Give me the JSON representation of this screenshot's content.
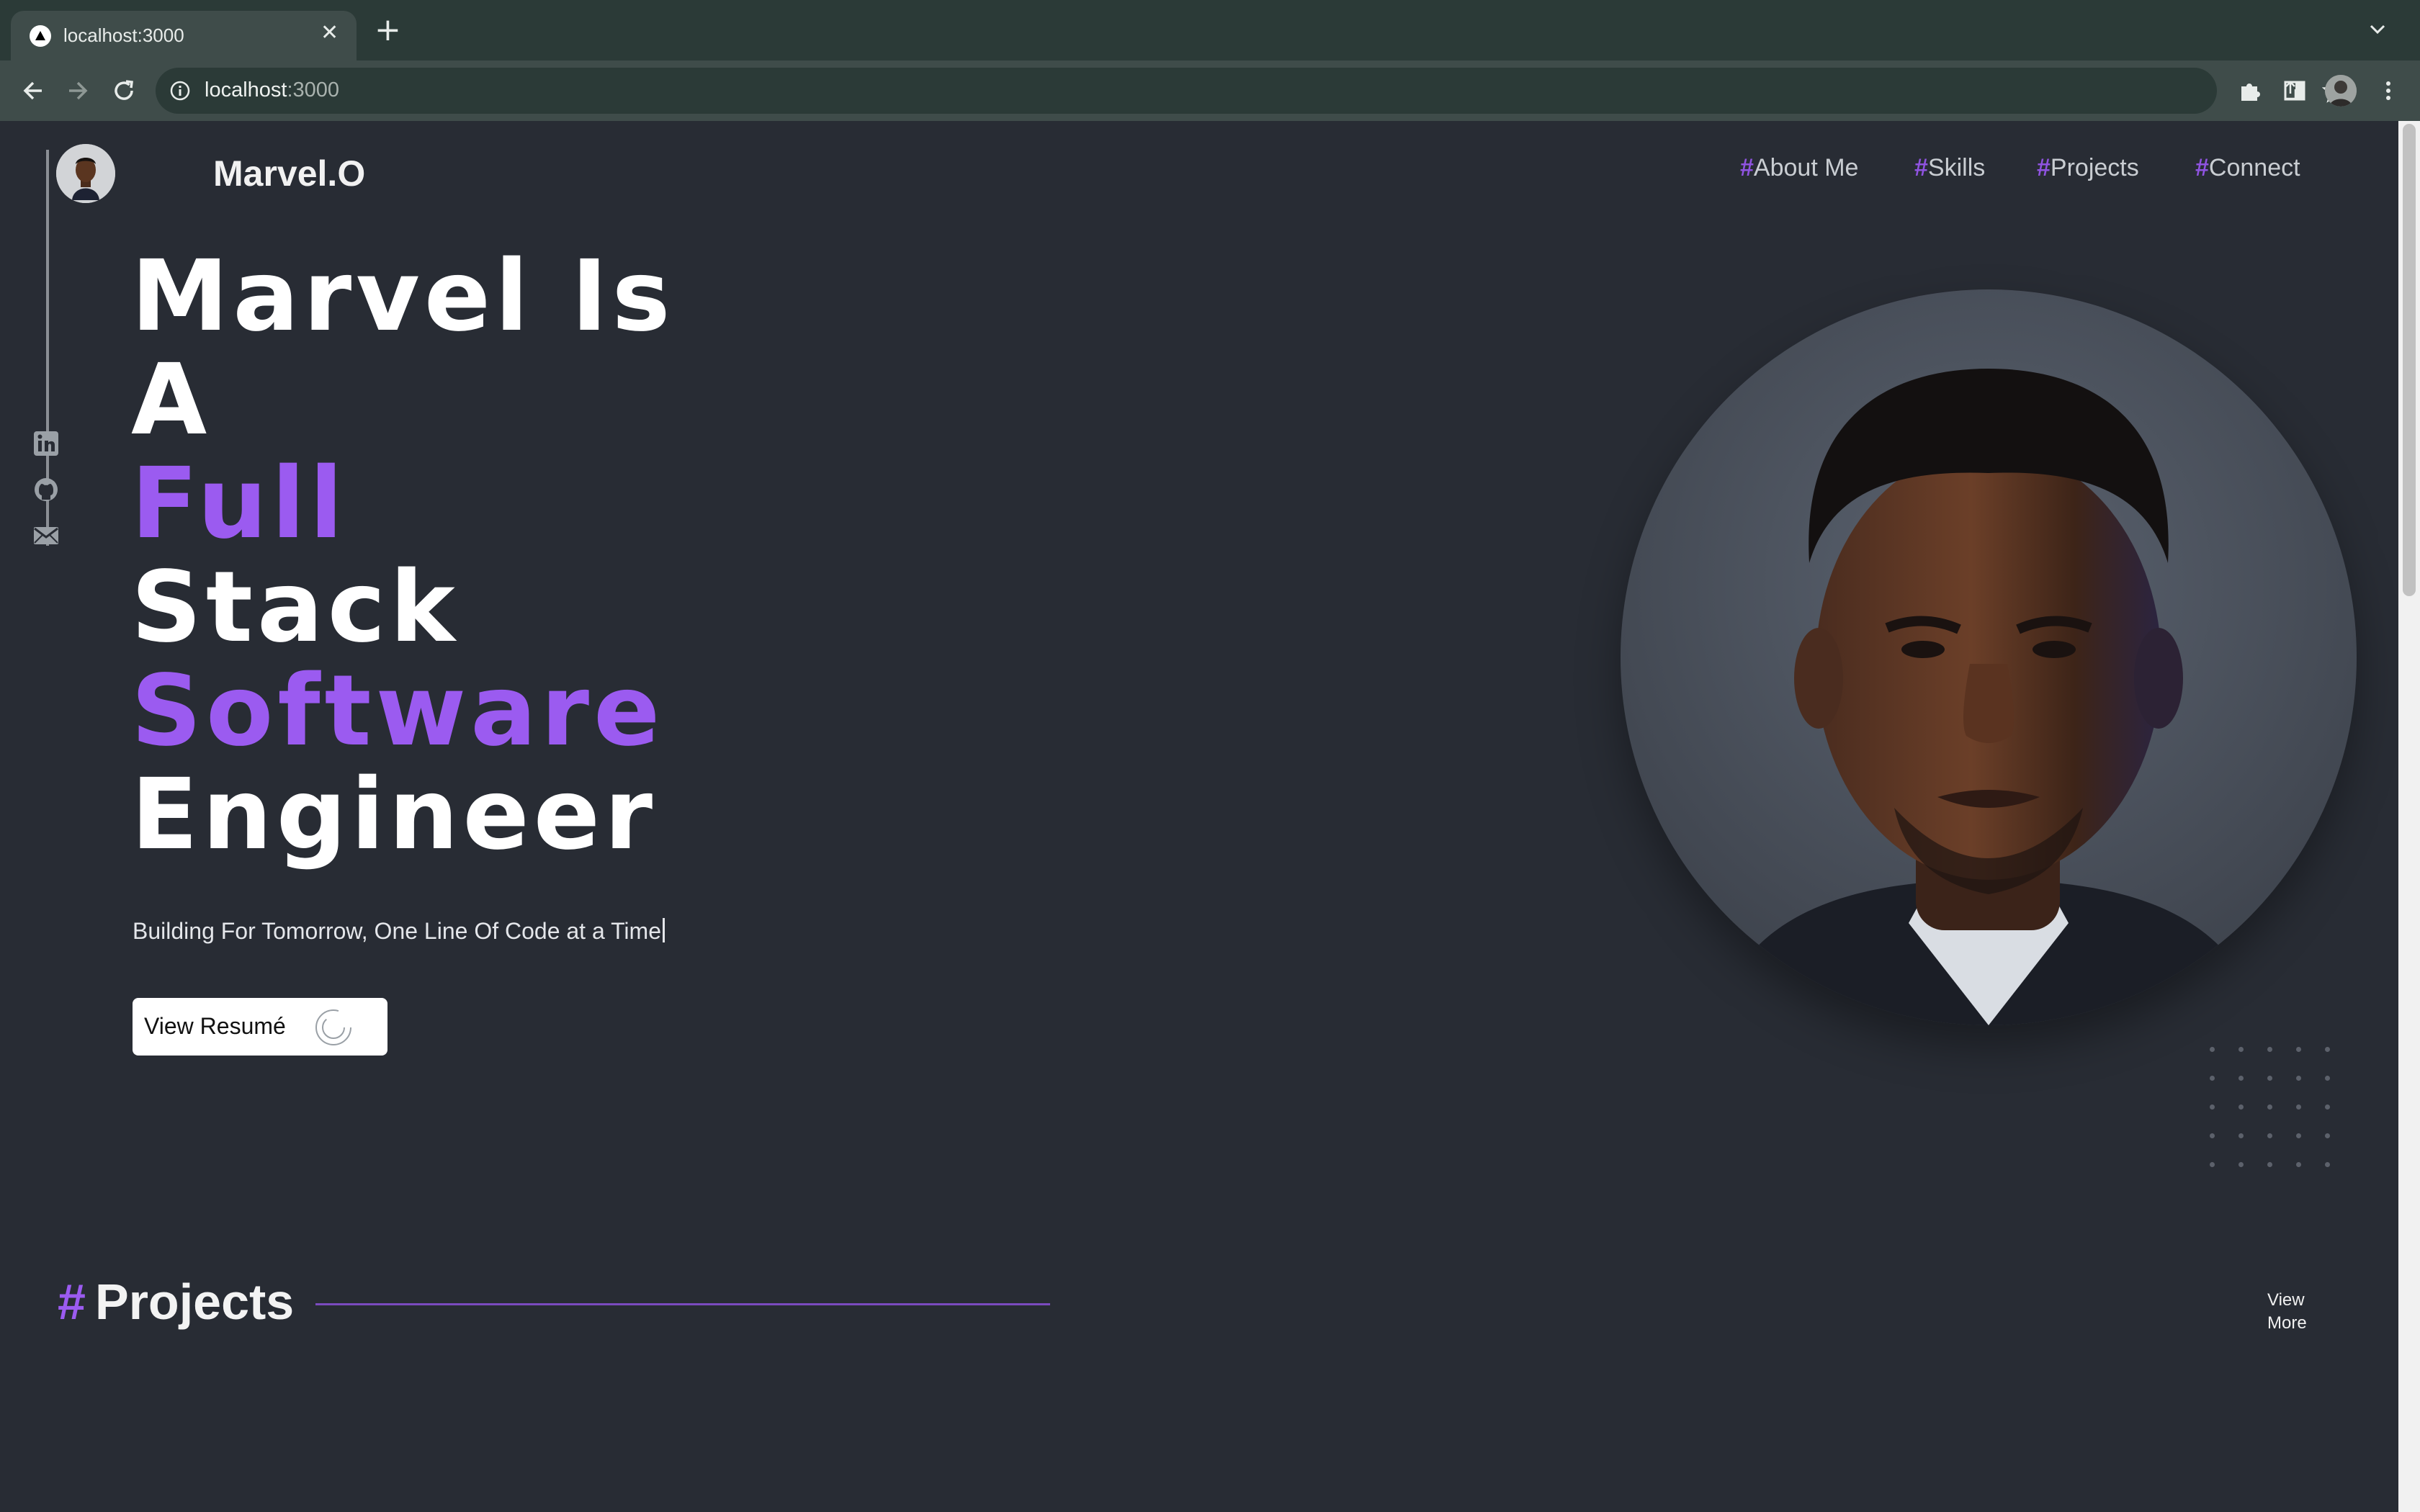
{
  "browser": {
    "tab_title": "localhost:3000",
    "tab_close": "✕",
    "new_tab": "+",
    "url_host": "localhost",
    "url_port": ":3000"
  },
  "site": {
    "brand": "Marvel.O",
    "nav": [
      {
        "hash": "#",
        "label": "About Me"
      },
      {
        "hash": "#",
        "label": "Skills"
      },
      {
        "hash": "#",
        "label": "Projects"
      },
      {
        "hash": "#",
        "label": "Connect"
      }
    ],
    "social_icons": [
      "linkedin-icon",
      "github-icon",
      "mail-icon"
    ],
    "headline": {
      "line1": "Marvel Is",
      "line2": "A",
      "line3": "Full",
      "line4": "Stack",
      "line5": "Software",
      "line6": "Engineer"
    },
    "tagline": "Building For Tomorrow, One Line Of Code at a Time",
    "resume_button": "View Resumé",
    "projects": {
      "hash": "#",
      "title": "Projects",
      "view_more_1": "View",
      "view_more_2": "More"
    }
  },
  "colors": {
    "background": "#282c34",
    "accent": "#9b5bf0",
    "chrome_dark": "#2b3a37",
    "chrome_light": "#3f4c4a"
  }
}
